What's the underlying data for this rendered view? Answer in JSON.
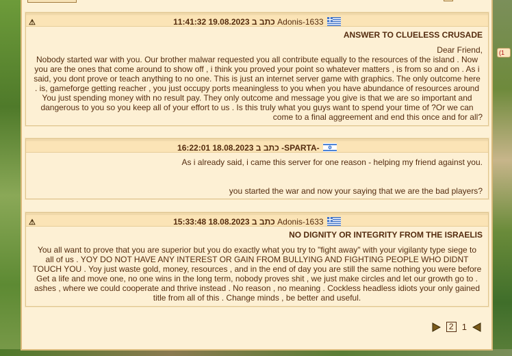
{
  "side_badge": "(1",
  "messages": [
    {
      "header": {
        "time": "11:41:32 19.08.2023",
        "wrote": "כתב ב",
        "sender": "Adonis-1633",
        "flag": "greece",
        "warning_icon": "warning-icon"
      },
      "subject": "ANSWER TO CLUELESS CRUSADE",
      "lines": [
        ",Dear Friend",
        "Nobody started war with you. Our brother malwar requested you all contribute equally to the resources of the island . Now",
        "you are the ones that come around to show off , i think you proved your point so whatever matters , is from so and on . As i",
        "said, you dont prove or teach anything to no one. This is just an internet server game with graphics. The only outcome here",
        "is, gameforge getting reacher , you just occupy ports meaningless to you when you have abundance of resources around .",
        "You just spending money with no result pay. They only outcome and message you give is that we are so important and",
        "dangerous to you so you keep all of your effort to us . Is this truly what you guys want to spend your time of ?Or we can",
        "?come to a final aggreement and end this once and for all"
      ]
    },
    {
      "header": {
        "time": "16:22:01 18.08.2023",
        "wrote": "כתב ב",
        "sender": "-SPARTA-",
        "flag": "israel"
      },
      "subject": "",
      "lines": [
        ".As i already said, i came this server for one reason - helping my friend against you",
        "",
        "",
        "?you started the war and now your saying that we are the bad players"
      ]
    },
    {
      "header": {
        "time": "15:33:48 18.08.2023",
        "wrote": "כתב ב",
        "sender": "Adonis-1633",
        "flag": "greece",
        "warning_icon": "warning-icon"
      },
      "subject": "NO DIGNITY OR INTEGRITY FROM THE ISRAELIS",
      "lines": [
        "You all want to prove that you are superior but you do exactly what you try to \"fight away\" with your vigilanty type siege to",
        "all of us . YOY DO NOT HAVE ANY INTEREST OR GAIN FROM BULLYING AND FIGHTING PEOPLE WHO DIDNT",
        "TOUCH YOU . Yoy just waste gold, money, resources , and in the end of day you are still the same nothing you were before",
        ". Get a life and move one, no one wins in the long term, nobody proves shit , we just make circles and let our growth go to",
        "ashes , where we could cooperate and thrive instead . No reason , no meaning . Cockless headless idiots your only gained",
        ".title from all of this . Change minds , be better and useful"
      ]
    }
  ],
  "pager": {
    "current": "2",
    "other": "1"
  }
}
